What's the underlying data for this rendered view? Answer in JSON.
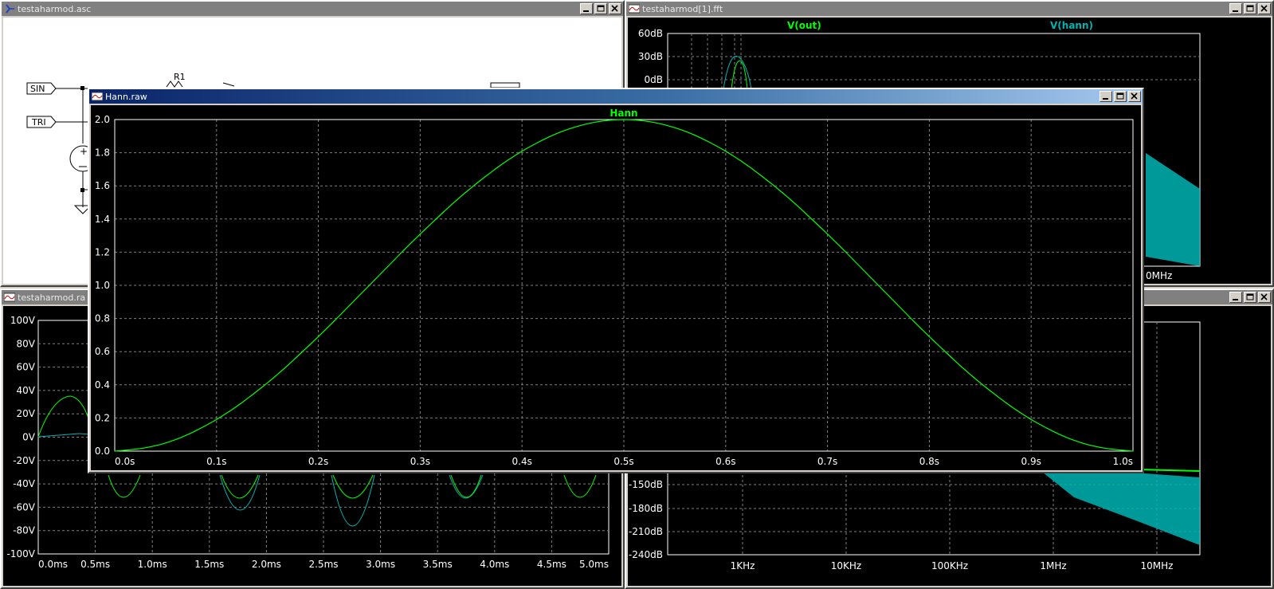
{
  "windows": {
    "schematic": {
      "title": "testaharmod.asc",
      "labels": {
        "sin": "SIN",
        "tri": "TRI",
        "r1": "R1"
      }
    },
    "fft": {
      "title": "testaharmod[1].fft",
      "traces": [
        "V(out)",
        "V(hann)"
      ],
      "y_ticks_top": [
        "60dB",
        "30dB",
        "0dB"
      ],
      "x_tick_partial": "0MHz"
    },
    "transient": {
      "title": "testaharmod.ra",
      "y_ticks": [
        "100V",
        "80V",
        "60V",
        "40V",
        "20V",
        "0V",
        "-20V",
        "-40V",
        "-60V",
        "-80V",
        "-100V"
      ],
      "x_ticks": [
        "0.0ms",
        "0.5ms",
        "1.0ms",
        "1.5ms",
        "2.0ms",
        "2.5ms",
        "3.0ms",
        "3.5ms",
        "4.0ms",
        "4.5ms",
        "5.0ms"
      ]
    },
    "fft2": {
      "y_ticks": [
        "-150dB",
        "-180dB",
        "-210dB",
        "-240dB"
      ],
      "x_ticks": [
        "1KHz",
        "10KHz",
        "100KHz",
        "1MHz",
        "10MHz"
      ]
    },
    "hann": {
      "title": "Hann.raw"
    }
  },
  "chart_data": [
    {
      "type": "line",
      "title": "Hann",
      "x": [
        0.0,
        0.05,
        0.1,
        0.15,
        0.2,
        0.25,
        0.3,
        0.35,
        0.4,
        0.45,
        0.5,
        0.55,
        0.6,
        0.65,
        0.7,
        0.75,
        0.8,
        0.85,
        0.9,
        0.95,
        1.0
      ],
      "series": [
        {
          "name": "Hann",
          "color": "#00ff00",
          "values": [
            0.0,
            0.049,
            0.191,
            0.412,
            0.691,
            1.0,
            1.309,
            1.588,
            1.809,
            1.951,
            2.0,
            1.951,
            1.809,
            1.588,
            1.309,
            1.0,
            0.691,
            0.412,
            0.191,
            0.049,
            0.0
          ]
        }
      ],
      "x_ticks": [
        "0.0s",
        "0.1s",
        "0.2s",
        "0.3s",
        "0.4s",
        "0.5s",
        "0.6s",
        "0.7s",
        "0.8s",
        "0.9s",
        "1.0s"
      ],
      "y_ticks": [
        "2.0",
        "1.8",
        "1.6",
        "1.4",
        "1.2",
        "1.0",
        "0.8",
        "0.6",
        "0.4",
        "0.2",
        "0.0"
      ],
      "xlim": [
        0,
        1
      ],
      "ylim": [
        0,
        2
      ],
      "grid": true
    }
  ],
  "colors": {
    "green": "#00ff00",
    "cyan": "#00b4b4",
    "plot_bg": "#000000",
    "grid": "#808080"
  }
}
